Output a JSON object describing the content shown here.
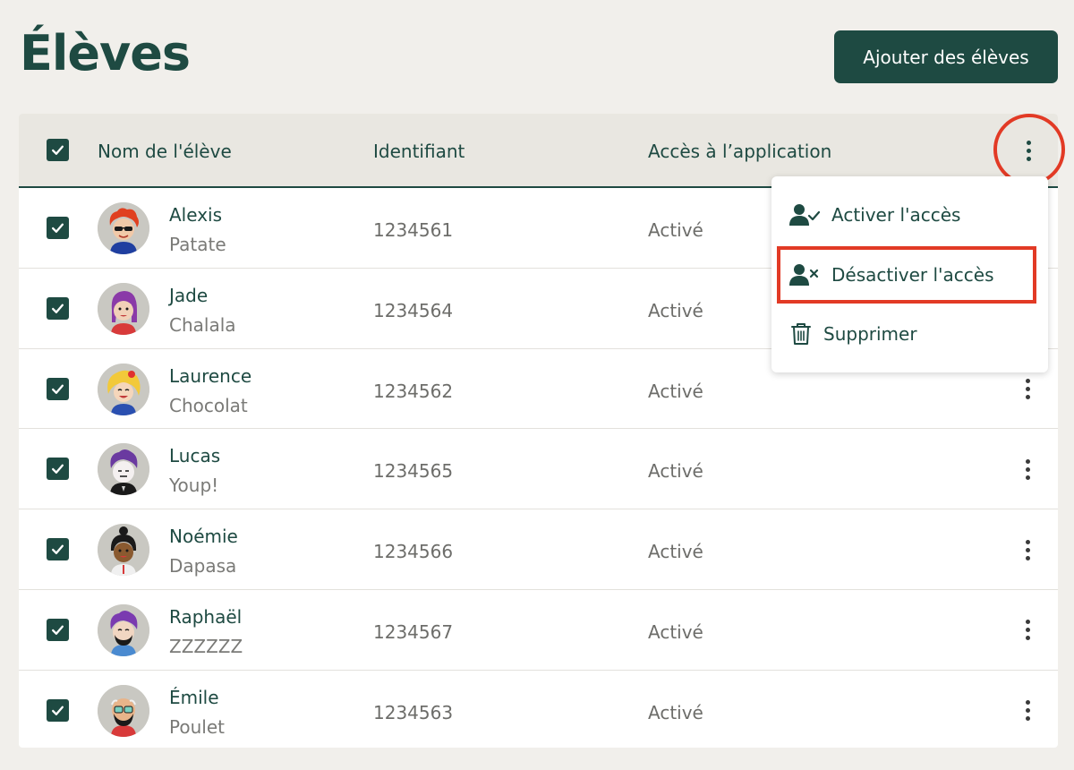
{
  "page": {
    "title": "Élèves"
  },
  "toolbar": {
    "add_label": "Ajouter des élèves"
  },
  "table": {
    "headers": {
      "name": "Nom de l'élève",
      "id": "Identifiant",
      "access": "Accès à l’application"
    },
    "rows": [
      {
        "first": "Alexis",
        "last": "Patate",
        "id": "1234561",
        "access": "Activé",
        "checked": true,
        "avatar": "avatar-red-curly-hair-sunglasses"
      },
      {
        "first": "Jade",
        "last": "Chalala",
        "id": "1234564",
        "access": "Activé",
        "checked": true,
        "avatar": "avatar-purple-hair"
      },
      {
        "first": "Laurence",
        "last": "Chocolat",
        "id": "1234562",
        "access": "Activé",
        "checked": true,
        "avatar": "avatar-blonde-hair-flower"
      },
      {
        "first": "Lucas",
        "last": "Youp!",
        "id": "1234565",
        "access": "Activé",
        "checked": true,
        "avatar": "avatar-purple-curly-hair"
      },
      {
        "first": "Noémie",
        "last": "Dapasa",
        "id": "1234566",
        "access": "Activé",
        "checked": true,
        "avatar": "avatar-dark-bun-hair"
      },
      {
        "first": "Raphaël",
        "last": "ZZZZZZ",
        "id": "1234567",
        "access": "Activé",
        "checked": true,
        "avatar": "avatar-purple-hair-beard"
      },
      {
        "first": "Émile",
        "last": "Poulet",
        "id": "1234563",
        "access": "Activé",
        "checked": true,
        "avatar": "avatar-bald-glasses-beard"
      }
    ]
  },
  "menu": {
    "items": [
      {
        "label": "Activer l'accès",
        "icon": "user-check-icon"
      },
      {
        "label": "Désactiver l'accès",
        "icon": "user-x-icon"
      },
      {
        "label": "Supprimer",
        "icon": "trash-icon"
      }
    ]
  },
  "colors": {
    "brand": "#1e4a42",
    "background": "#f1efeb",
    "header_bg": "#e9e7e1",
    "highlight": "#e23a25"
  }
}
